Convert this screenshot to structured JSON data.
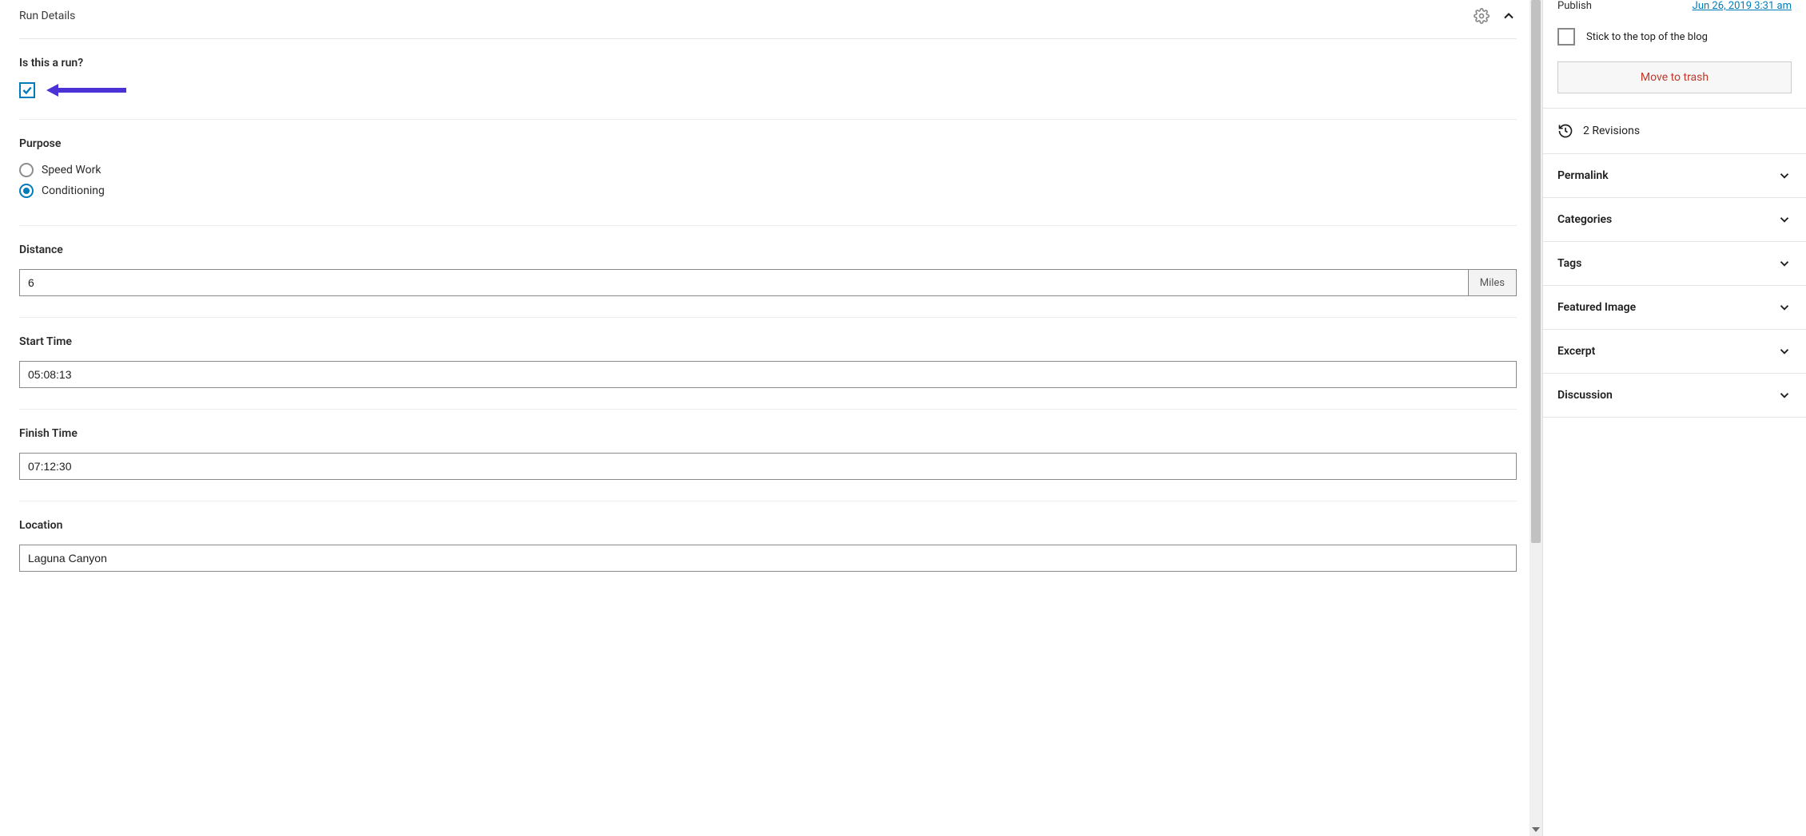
{
  "panel": {
    "title": "Run Details"
  },
  "fields": {
    "is_run": {
      "label": "Is this a run?",
      "checked": true
    },
    "purpose": {
      "label": "Purpose",
      "options": [
        {
          "label": "Speed Work",
          "selected": false
        },
        {
          "label": "Conditioning",
          "selected": true
        }
      ]
    },
    "distance": {
      "label": "Distance",
      "value": "6",
      "unit": "Miles"
    },
    "start_time": {
      "label": "Start Time",
      "value": "05:08:13"
    },
    "finish_time": {
      "label": "Finish Time",
      "value": "07:12:30"
    },
    "location": {
      "label": "Location",
      "value": "Laguna Canyon"
    }
  },
  "sidebar": {
    "publish": {
      "label": "Publish",
      "link": "Jun 26, 2019 3:31 am"
    },
    "stick_label": "Stick to the top of the blog",
    "trash_label": "Move to trash",
    "revisions_label": "2 Revisions",
    "sections": [
      {
        "title": "Permalink"
      },
      {
        "title": "Categories"
      },
      {
        "title": "Tags"
      },
      {
        "title": "Featured Image"
      },
      {
        "title": "Excerpt"
      },
      {
        "title": "Discussion"
      }
    ]
  }
}
